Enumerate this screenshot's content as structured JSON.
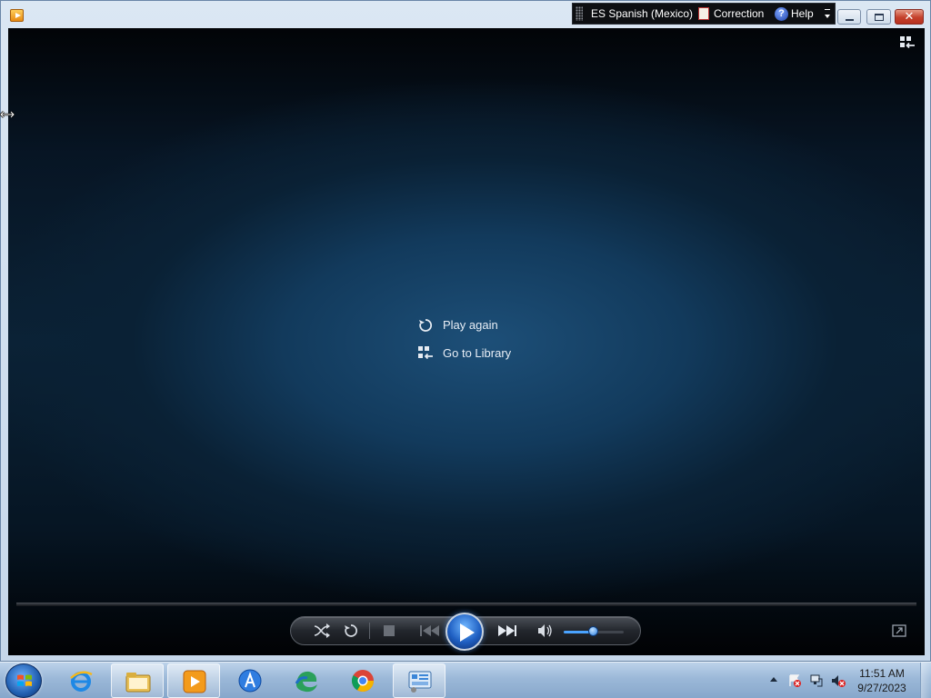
{
  "language_bar": {
    "language": "ES Spanish (Mexico)",
    "correction": "Correction",
    "help": "Help"
  },
  "player": {
    "play_again": "Play again",
    "go_to_library": "Go to Library",
    "volume_level": 0.5
  },
  "taskbar": {
    "apps": [
      {
        "name": "Internet Explorer",
        "icon": "ie-icon",
        "active": false
      },
      {
        "name": "Windows Explorer",
        "icon": "folder-icon",
        "active": true
      },
      {
        "name": "Windows Media Player",
        "icon": "media-player-icon",
        "active": true
      },
      {
        "name": "App",
        "icon": "a-app-icon",
        "active": false
      },
      {
        "name": "Edge",
        "icon": "edge-icon",
        "active": false
      },
      {
        "name": "Chrome",
        "icon": "chrome-icon",
        "active": false
      },
      {
        "name": "Control Panel",
        "icon": "control-panel-icon",
        "active": true
      }
    ],
    "clock": {
      "time": "11:51 AM",
      "date": "9/27/2023"
    }
  },
  "colors": {
    "accent": "#1f5fc2",
    "close": "#c4402b"
  }
}
